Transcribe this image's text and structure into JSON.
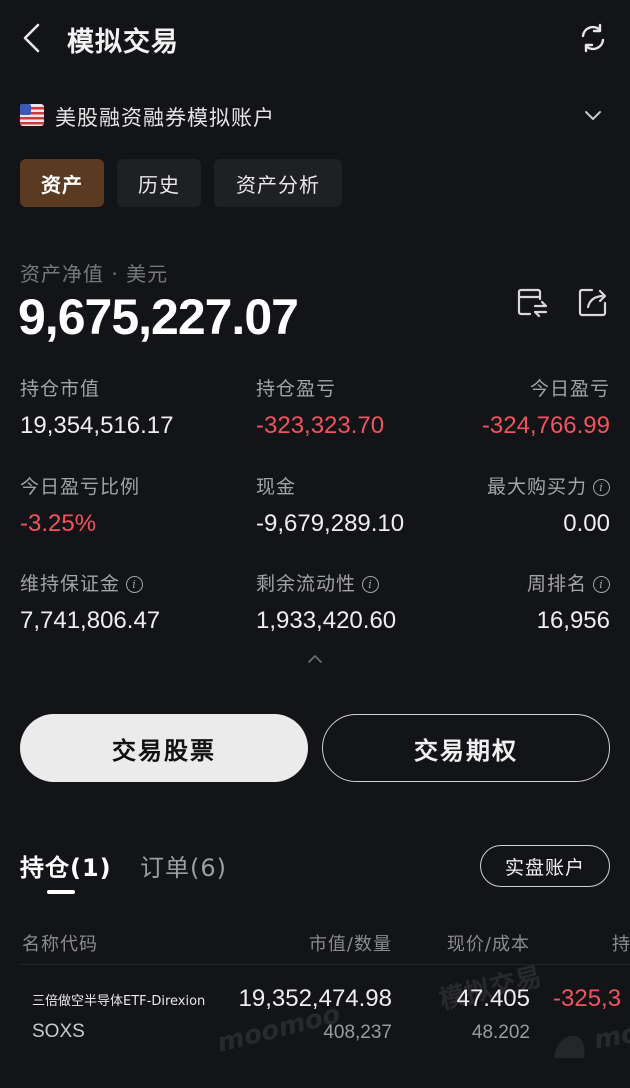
{
  "header": {
    "title": "模拟交易",
    "back_icon": "chevron-left-icon",
    "refresh_icon": "refresh-icon"
  },
  "account": {
    "flag": "us-flag-icon",
    "name": "美股融资融券模拟账户",
    "chevron": "chevron-down-icon"
  },
  "tabs": [
    {
      "label": "资产",
      "active": true
    },
    {
      "label": "历史",
      "active": false
    },
    {
      "label": "资产分析",
      "active": false
    }
  ],
  "summary": {
    "label": "资产净值 · 美元",
    "value": "9,675,227.07"
  },
  "metrics": {
    "market_value": {
      "label": "持仓市值",
      "value": "19,354,516.17"
    },
    "position_pl": {
      "label": "持仓盈亏",
      "value": "-323,323.70"
    },
    "today_pl": {
      "label": "今日盈亏",
      "value": "-324,766.99"
    },
    "today_pl_ratio": {
      "label": "今日盈亏比例",
      "value": "-3.25%"
    },
    "cash": {
      "label": "现金",
      "value": "-9,679,289.10"
    },
    "max_buying_power": {
      "label": "最大购买力",
      "value": "0.00"
    },
    "maintenance_margin": {
      "label": "维持保证金",
      "value": "7,741,806.47"
    },
    "remaining_liquidity": {
      "label": "剩余流动性",
      "value": "1,933,420.60"
    },
    "weekly_rank": {
      "label": "周排名",
      "value": "16,956"
    }
  },
  "actions": {
    "trade_stock": "交易股票",
    "trade_option": "交易期权"
  },
  "positions_tabs": {
    "positions": "持仓(1)",
    "orders": "订单(6)",
    "real_account": "实盘账户"
  },
  "table": {
    "headers": {
      "name": "名称代码",
      "value_qty": "市值/数量",
      "price_cost": "现价/成本",
      "pl": "持"
    },
    "rows": [
      {
        "name": "三倍做空半导体ETF-Direxion",
        "code": "SOXS",
        "market_value": "19,352,474.98",
        "quantity": "408,237",
        "price": "47.405",
        "cost": "48.202",
        "pl": "-325,3"
      }
    ]
  },
  "watermark": {
    "text1": "模拟交易",
    "text2": "moomoo",
    "text3": "mo"
  },
  "colors": {
    "background": "#131417",
    "negative": "#f0545e",
    "active_tab": "#5b3a22"
  }
}
